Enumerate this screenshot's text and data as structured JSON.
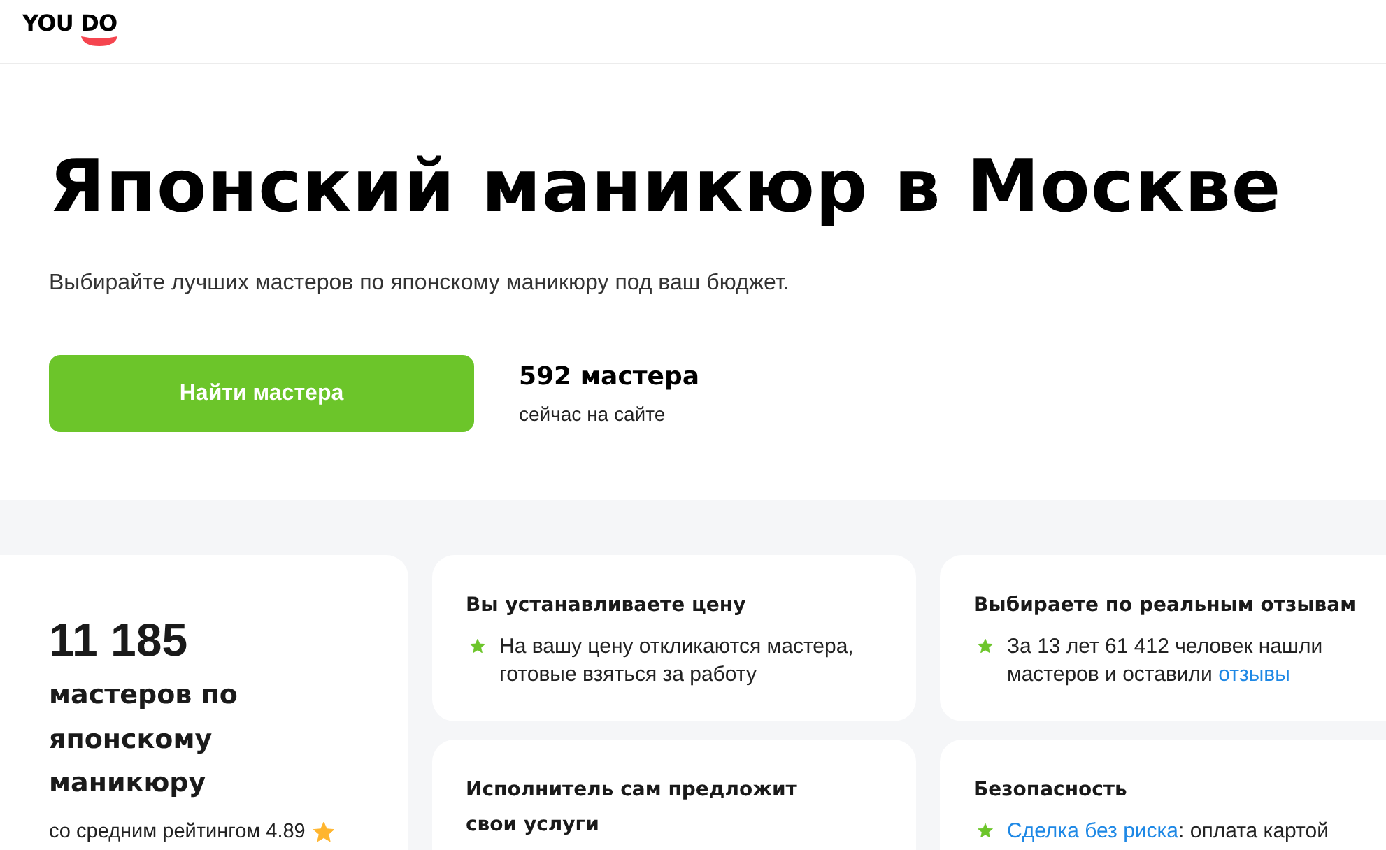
{
  "header": {
    "logo": "YOU DO"
  },
  "hero": {
    "title": "Японский маникюр в Москве",
    "subtitle": "Выбирайте лучших мастеров по японскому маникюру под ваш бюджет.",
    "cta_button": "Найти мастера",
    "online_count": "592 мастера",
    "online_caption": "сейчас на сайте"
  },
  "stats_card": {
    "count": "11 185",
    "caption": "мастеров по японскому маникюру",
    "rating": "со средним рейтингом 4.89"
  },
  "features": [
    {
      "title": "Вы устанавливаете цену",
      "points": [
        {
          "parts": [
            {
              "kind": "text",
              "text": "На вашу цену откликаются мастера, готовые взяться за работу"
            }
          ]
        }
      ]
    },
    {
      "title": "Выбираете по реальным отзывам",
      "points": [
        {
          "parts": [
            {
              "kind": "text",
              "text": "За 13 лет 61 412 человек нашли мастеров и оставили "
            },
            {
              "kind": "link",
              "text": "отзывы"
            }
          ]
        }
      ]
    },
    {
      "title": "Исполнитель сам предложит свои услуги"
    },
    {
      "title": "Безопасность",
      "points": [
        {
          "parts": [
            {
              "kind": "link",
              "text": "Сделка без риска"
            },
            {
              "kind": "text",
              "text": ": оплата картой"
            }
          ]
        }
      ]
    }
  ]
}
